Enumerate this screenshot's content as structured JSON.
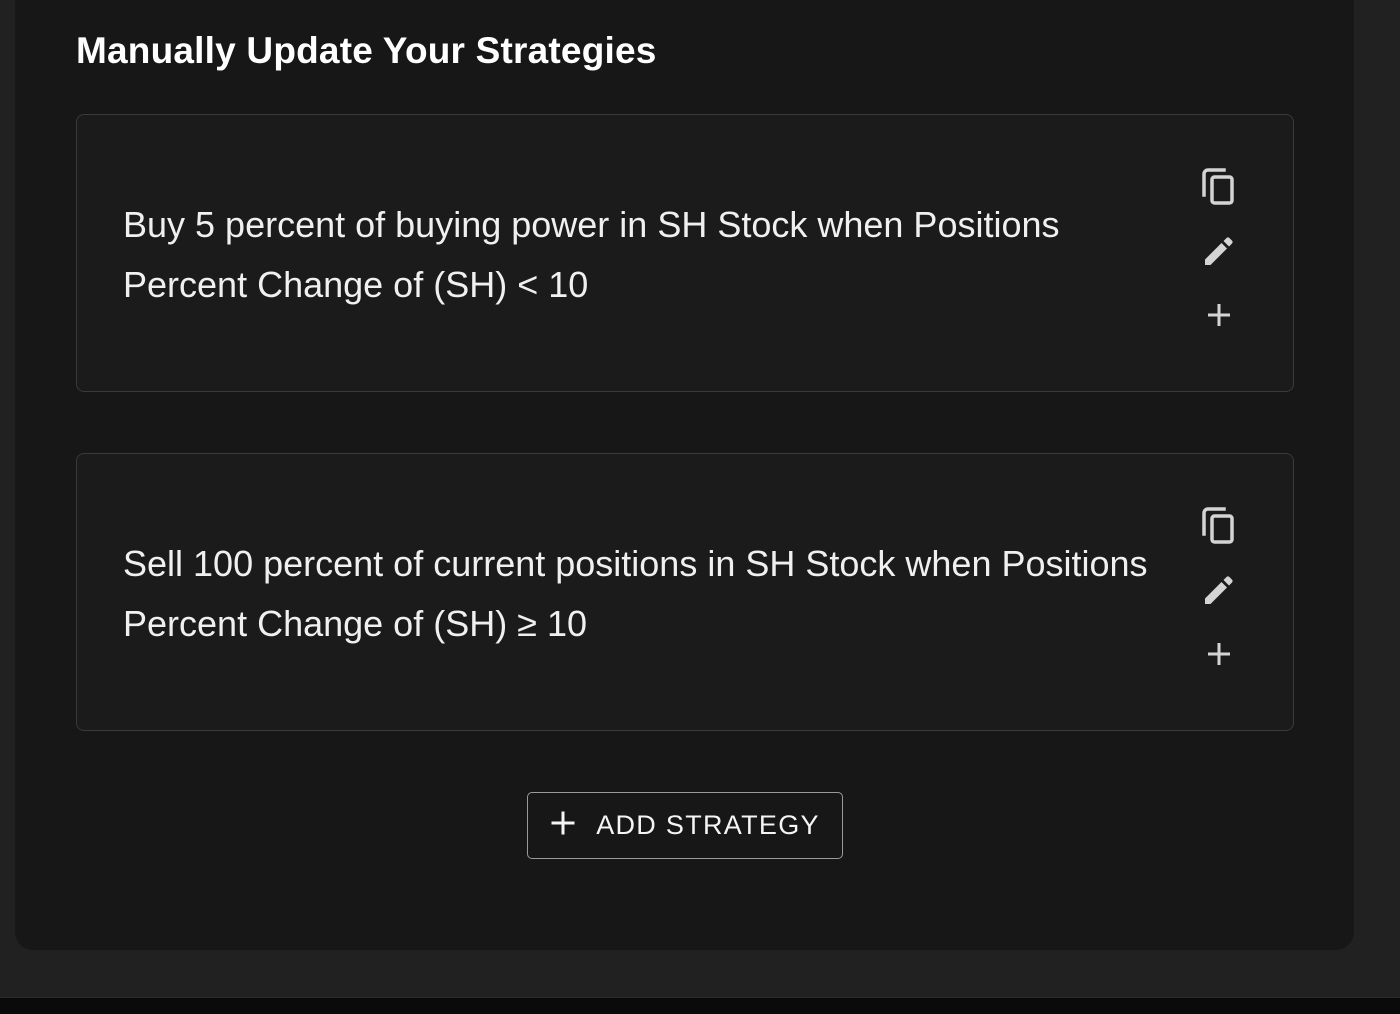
{
  "section": {
    "title": "Manually Update Your Strategies"
  },
  "strategies": [
    {
      "text": "Buy 5 percent of buying power in SH Stock when Positions Percent Change of (SH) < 10",
      "actions": {
        "copy_icon": "copy-icon",
        "edit_icon": "pencil-icon",
        "add_icon": "plus-icon"
      }
    },
    {
      "text": "Sell 100 percent of current positions in SH Stock when Positions Percent Change of (SH) ≥ 10",
      "actions": {
        "copy_icon": "copy-icon",
        "edit_icon": "pencil-icon",
        "add_icon": "plus-icon"
      }
    }
  ],
  "add_button": {
    "label": "ADD STRATEGY",
    "icon": "plus-icon"
  },
  "colors": {
    "background": "#212121",
    "panel": "#171717",
    "card": "#1b1b1b",
    "card_border": "#3a3a3a",
    "text": "#f0f0f0",
    "icon": "#d4d4d4"
  }
}
